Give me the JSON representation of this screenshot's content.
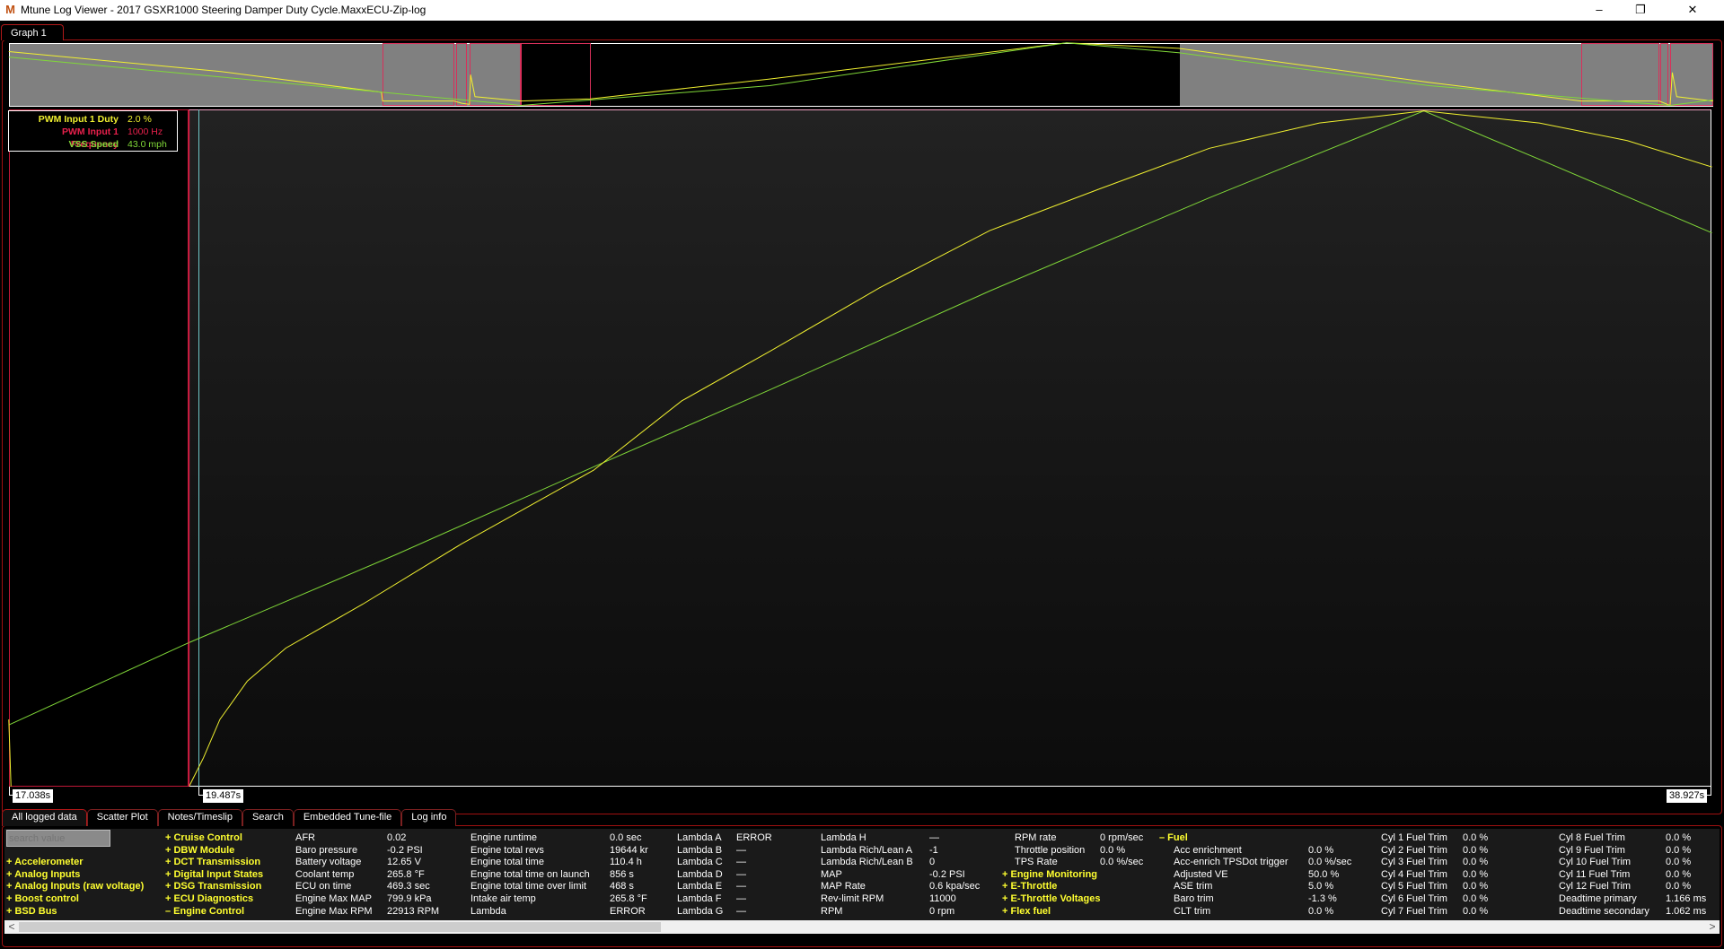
{
  "window": {
    "title": "Mtune Log Viewer - 2017 GSXR1000 Steering Damper Duty Cycle.MaxxECU-Zip-log",
    "icons": {
      "app": "mtune-logo-icon",
      "minimize": "minimize-icon",
      "restore": "restore-icon",
      "close": "close-icon"
    }
  },
  "graph_tabs": [
    {
      "label": "Graph 1"
    }
  ],
  "legend": [
    {
      "name": "PWM Input 1 Duty",
      "value": "2.0 %",
      "color": "#f0f030"
    },
    {
      "name": "PWM Input 1 Frequency",
      "value": "1000 Hz",
      "color": "#e8204c"
    },
    {
      "name": "VSS Speed",
      "value": "43.0 mph",
      "color": "#80d838"
    }
  ],
  "time_markers": {
    "start": "17.038s",
    "cursor": "19.487s",
    "end": "38.927s"
  },
  "bottom_tabs": [
    {
      "label": "All logged data",
      "active": true
    },
    {
      "label": "Scatter Plot"
    },
    {
      "label": "Notes/Timeslip"
    },
    {
      "label": "Search"
    },
    {
      "label": "Embedded Tune-file"
    },
    {
      "label": "Log info"
    }
  ],
  "search": {
    "placeholder": "search value",
    "value": ""
  },
  "data_panel": {
    "groups_left": [
      "+ Accelerometer",
      "+ Analog Inputs",
      "+ Analog Inputs (raw voltage)",
      "+ Boost control",
      "+ BSD Bus"
    ],
    "groups_mid": [
      "+ Cruise Control",
      "+ DBW Module",
      "+ DCT Transmission",
      "+ Digital Input States",
      "+ DSG Transmission",
      "+ ECU Diagnostics",
      "– Engine Control"
    ],
    "columns": [
      [
        [
          "AFR",
          "0.02"
        ],
        [
          "Baro pressure",
          "-0.2 PSI"
        ],
        [
          "Battery voltage",
          "12.65 V"
        ],
        [
          "Coolant temp",
          "265.8 °F"
        ],
        [
          "ECU on time",
          "469.3 sec"
        ],
        [
          "Engine Max MAP",
          "799.9 kPa"
        ],
        [
          "Engine Max RPM",
          "22913 RPM"
        ]
      ],
      [
        [
          "Engine runtime",
          "0.0 sec"
        ],
        [
          "Engine total revs",
          "19644 kr"
        ],
        [
          "Engine total time",
          "110.4 h"
        ],
        [
          "Engine total time on launch",
          "856 s"
        ],
        [
          "Engine total time over limit",
          "468 s"
        ],
        [
          "Intake air temp",
          "265.8 °F"
        ],
        [
          "Lambda",
          "ERROR"
        ]
      ],
      [
        [
          "Lambda A",
          "ERROR"
        ],
        [
          "Lambda B",
          "—"
        ],
        [
          "Lambda C",
          "—"
        ],
        [
          "Lambda D",
          "—"
        ],
        [
          "Lambda E",
          "—"
        ],
        [
          "Lambda F",
          "—"
        ],
        [
          "Lambda G",
          "—"
        ]
      ],
      [
        [
          "Lambda H",
          "—"
        ],
        [
          "Lambda Rich/Lean A",
          "-1"
        ],
        [
          "Lambda Rich/Lean B",
          "0"
        ],
        [
          "MAP",
          "-0.2 PSI"
        ],
        [
          "MAP Rate",
          "0.6 kpa/sec"
        ],
        [
          "Rev-limit RPM",
          "11000"
        ],
        [
          "RPM",
          "0 rpm"
        ]
      ],
      [
        [
          "RPM rate",
          "0 rpm/sec"
        ],
        [
          "Throttle position",
          "0.0 %"
        ],
        [
          "TPS Rate",
          "0.0 %/sec"
        ]
      ],
      [
        [
          "Acc enrichment",
          "0.0 %"
        ],
        [
          "Acc-enrich TPSDot trigger",
          "0.0 %/sec"
        ],
        [
          "Adjusted VE",
          "50.0 %"
        ],
        [
          "ASE trim",
          "5.0 %"
        ],
        [
          "Baro trim",
          "-1.3 %"
        ],
        [
          "CLT trim",
          "0.0 %"
        ]
      ],
      [
        [
          "Cyl 1 Fuel Trim",
          "0.0 %"
        ],
        [
          "Cyl 2 Fuel Trim",
          "0.0 %"
        ],
        [
          "Cyl 3 Fuel Trim",
          "0.0 %"
        ],
        [
          "Cyl 4 Fuel Trim",
          "0.0 %"
        ],
        [
          "Cyl 5 Fuel Trim",
          "0.0 %"
        ],
        [
          "Cyl 6 Fuel Trim",
          "0.0 %"
        ],
        [
          "Cyl 7 Fuel Trim",
          "0.0 %"
        ]
      ],
      [
        [
          "Cyl 8 Fuel Trim",
          "0.0 %"
        ],
        [
          "Cyl 9 Fuel Trim",
          "0.0 %"
        ],
        [
          "Cyl 10 Fuel Trim",
          "0.0 %"
        ],
        [
          "Cyl 11 Fuel Trim",
          "0.0 %"
        ],
        [
          "Cyl 12 Fuel Trim",
          "0.0 %"
        ],
        [
          "Deadtime primary",
          "1.166 ms"
        ],
        [
          "Deadtime secondary",
          "1.062 ms"
        ]
      ]
    ],
    "groups_right": [
      "+ Engine Monitoring",
      "+ E-Throttle",
      "+ E-Throttle Voltages",
      "+ Flex fuel"
    ],
    "fuel_group": "– Fuel"
  },
  "scrollbar": {
    "left_arrow": "<",
    "right_arrow": ">"
  }
}
